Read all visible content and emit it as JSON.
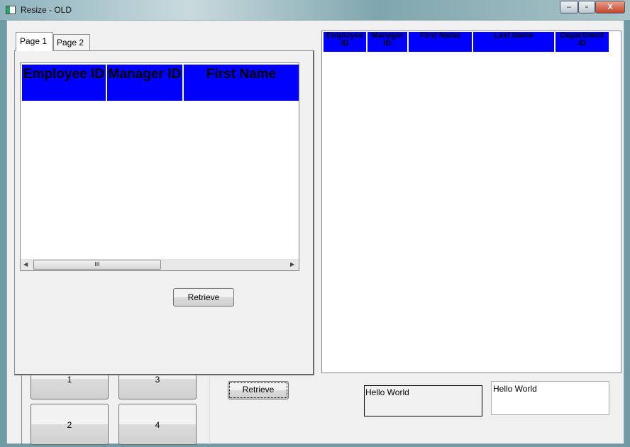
{
  "window": {
    "title": "Resize - OLD",
    "controls": [
      "minimize",
      "maximize",
      "close"
    ]
  },
  "tabs": [
    {
      "label": "Page 1",
      "active": true
    },
    {
      "label": "Page 2",
      "active": false
    }
  ],
  "left_grid": {
    "columns": [
      "Employee ID",
      "Manager ID",
      "First Name"
    ],
    "header_color": "#0000ff"
  },
  "page1_retrieve": "Retrieve",
  "number_buttons": [
    "1",
    "3",
    "2",
    "4"
  ],
  "retrieve_button": "Retrieve",
  "right_grid": {
    "columns": [
      "Employee ID",
      "Manager ID",
      "First Name",
      "Last Name",
      "Department ID"
    ],
    "header_color": "#0000ff"
  },
  "label_text": "Hello World",
  "textbox_value": "Hello World"
}
